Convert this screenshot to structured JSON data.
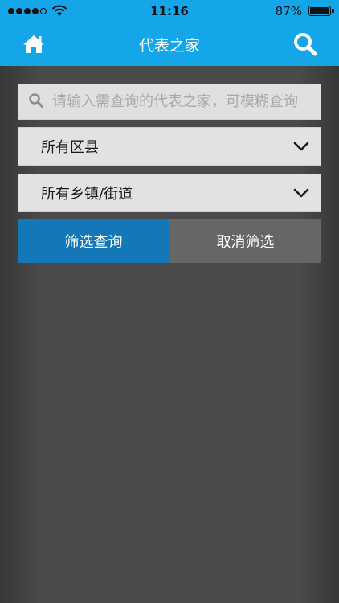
{
  "status_bar": {
    "time": "11:16",
    "battery_percent": "87%",
    "battery_level": 0.87,
    "signal_bars_filled": 4,
    "signal_bars_total": 5
  },
  "header": {
    "title": "代表之家",
    "left_icon": "home-icon",
    "right_icon": "search-icon"
  },
  "search": {
    "placeholder": "请输入需查询的代表之家，可模糊查询",
    "value": ""
  },
  "filters": {
    "district": "所有区县",
    "street": "所有乡镇/街道"
  },
  "buttons": {
    "filter": "筛选查询",
    "cancel": "取消筛选"
  },
  "colors": {
    "header": "#14a6e8",
    "primary_button": "#1478b8",
    "secondary_button": "#666666",
    "background": "#4a4a4a"
  }
}
